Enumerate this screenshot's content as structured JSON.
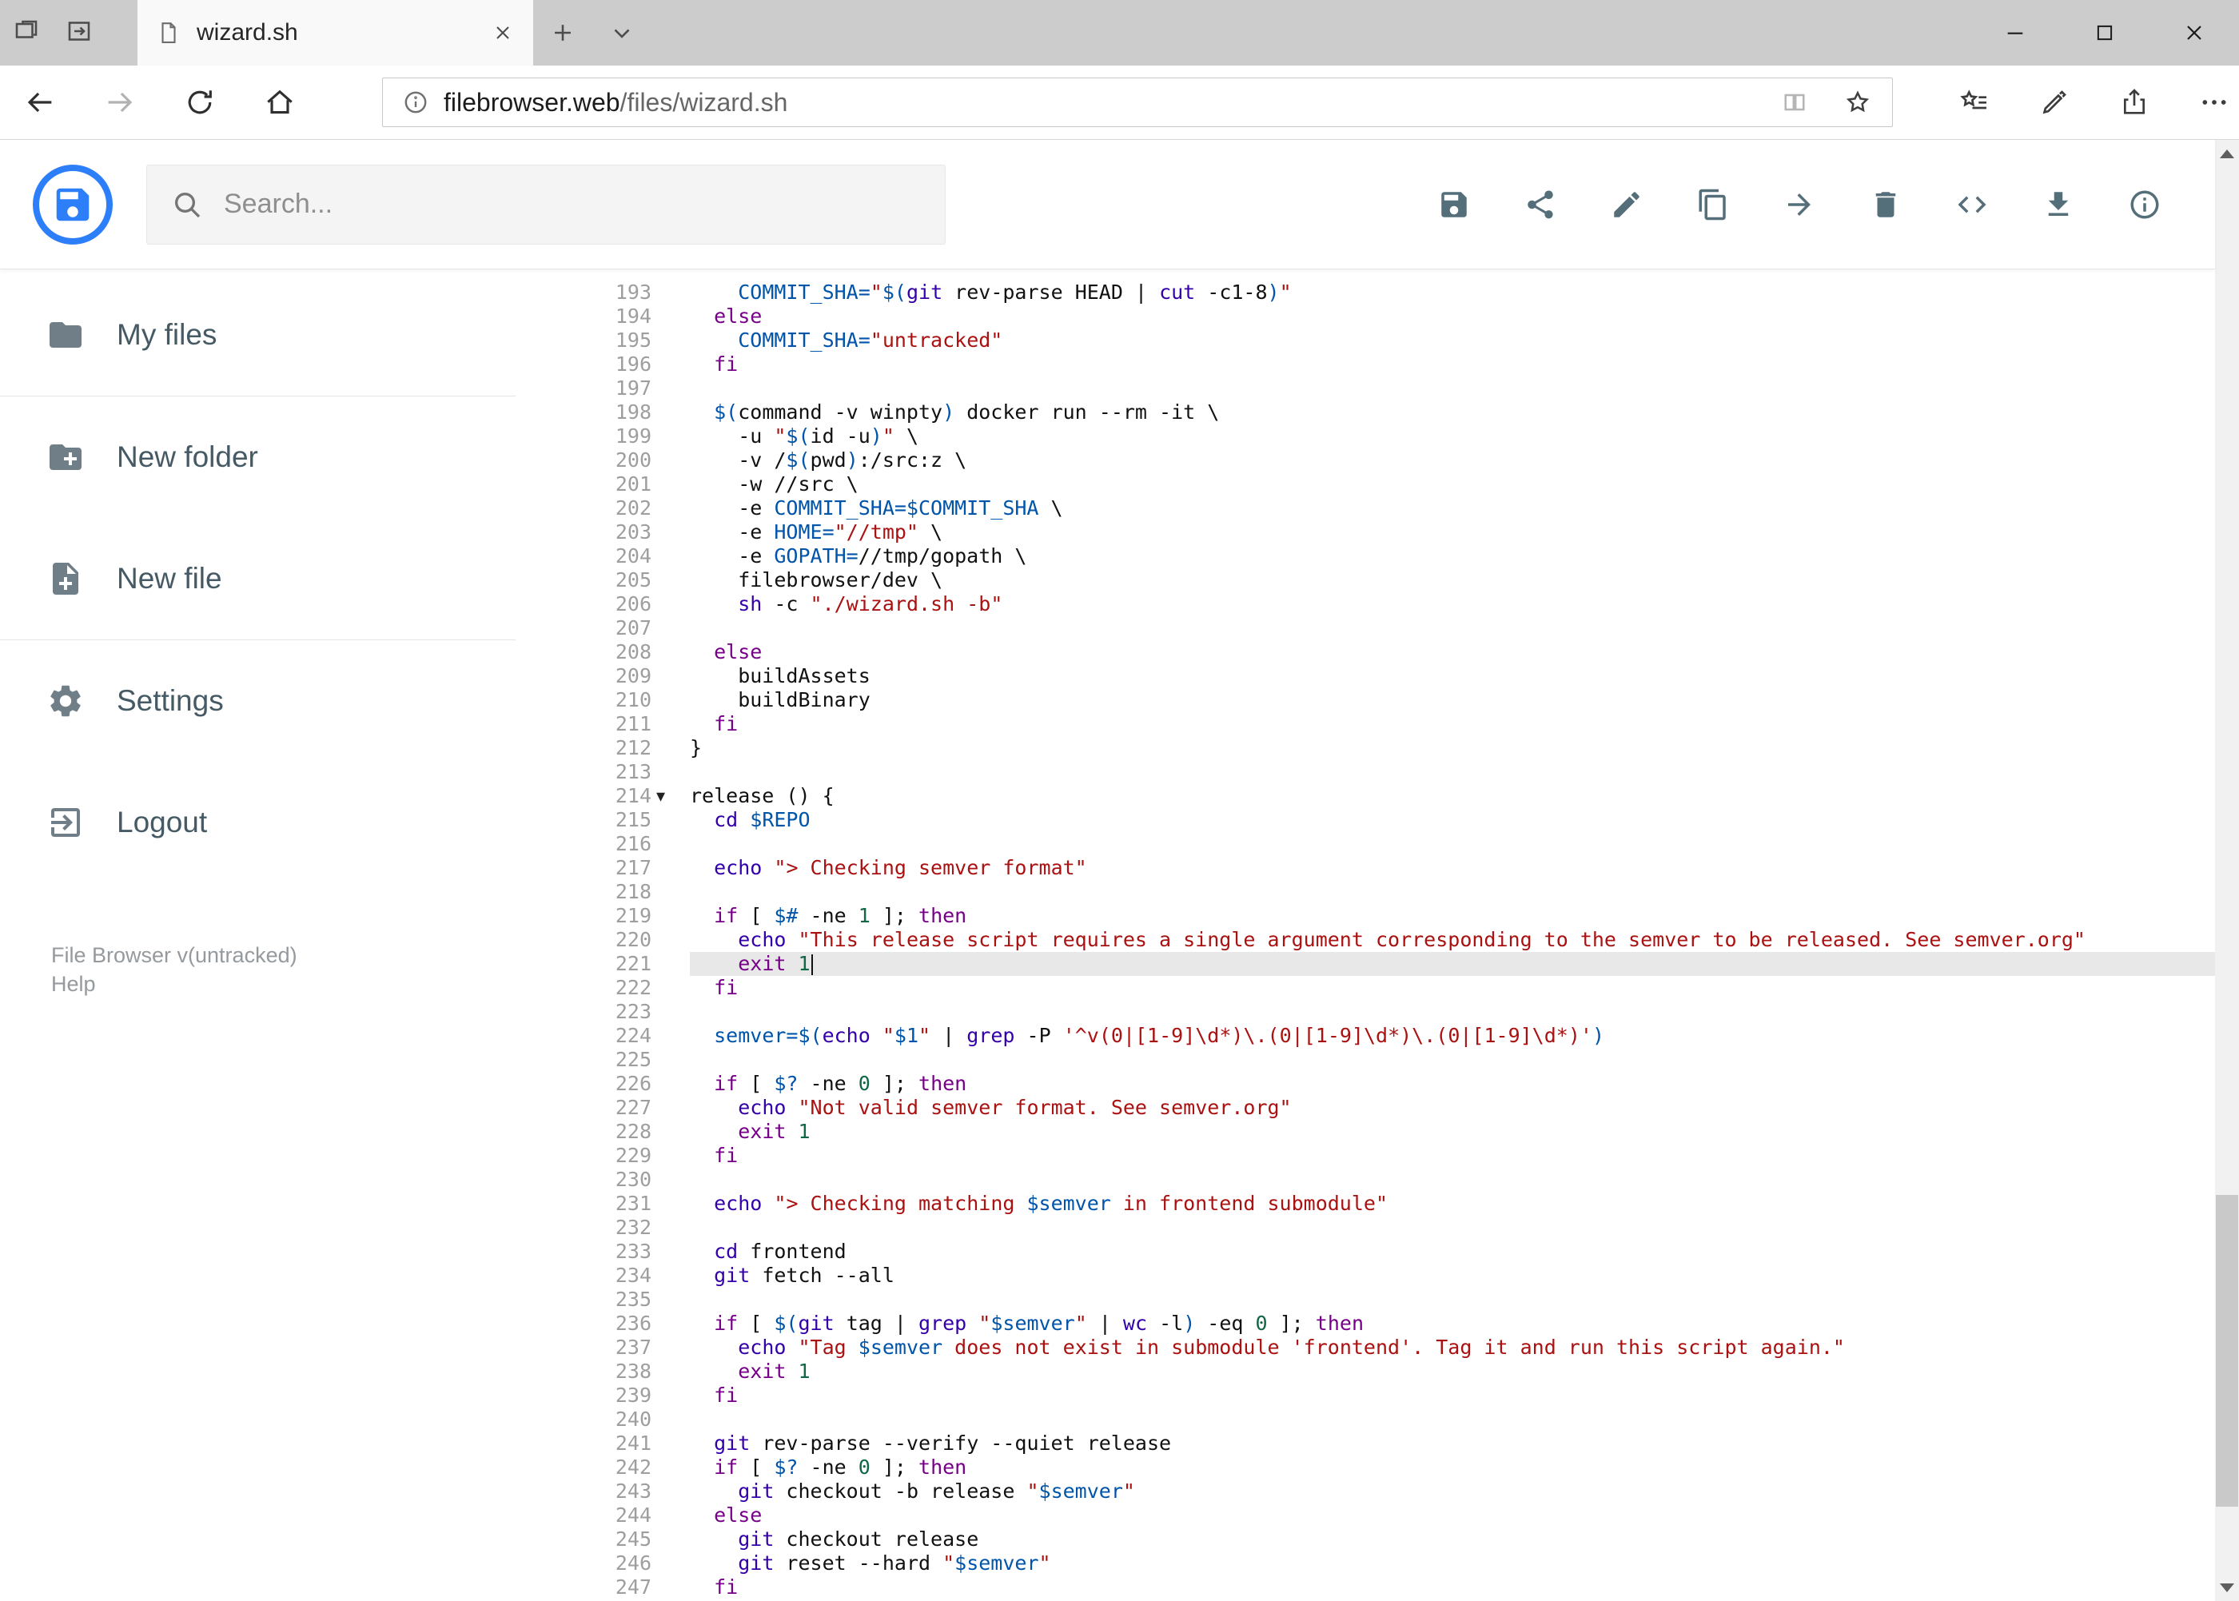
{
  "colors": {
    "accent": "#2d7ff9",
    "keyword": "#770088",
    "string": "#aa1111",
    "variable": "#0055aa",
    "number": "#116644",
    "builtin": "#3300aa"
  },
  "browser": {
    "tab_title": "wizard.sh",
    "url_domain": "filebrowser.web",
    "url_path": "/files/wizard.sh"
  },
  "header": {
    "search_placeholder": "Search...",
    "actions": [
      {
        "id": "save",
        "icon": "save"
      },
      {
        "id": "share",
        "icon": "share"
      },
      {
        "id": "edit",
        "icon": "pencil"
      },
      {
        "id": "copy",
        "icon": "copy"
      },
      {
        "id": "move",
        "icon": "arrow-forward"
      },
      {
        "id": "delete",
        "icon": "trash"
      },
      {
        "id": "code-view",
        "icon": "code"
      },
      {
        "id": "download",
        "icon": "download"
      },
      {
        "id": "info",
        "icon": "info"
      }
    ]
  },
  "sidebar": {
    "items": [
      {
        "id": "my-files",
        "label": "My files",
        "icon": "folder",
        "divider_after": true
      },
      {
        "id": "new-folder",
        "label": "New folder",
        "icon": "folder-plus",
        "divider_after": false
      },
      {
        "id": "new-file",
        "label": "New file",
        "icon": "file-plus",
        "divider_after": true
      },
      {
        "id": "settings",
        "label": "Settings",
        "icon": "gear",
        "divider_after": false
      },
      {
        "id": "logout",
        "label": "Logout",
        "icon": "logout",
        "divider_after": false
      }
    ],
    "footer_version": "File Browser v(untracked)",
    "footer_help": "Help"
  },
  "editor": {
    "active_line": 221,
    "fold_line": 214,
    "fold_marker": "▾",
    "lines": [
      {
        "n": 193,
        "t": [
          [
            "p",
            "    "
          ],
          [
            "v",
            "COMMIT_SHA="
          ],
          [
            "s",
            "\""
          ],
          [
            "v",
            "$("
          ],
          [
            "b",
            "git"
          ],
          [
            "p",
            " rev-parse HEAD | "
          ],
          [
            "b",
            "cut"
          ],
          [
            "p",
            " -c1-8"
          ],
          [
            "v",
            ")"
          ],
          [
            "s",
            "\""
          ]
        ]
      },
      {
        "n": 194,
        "t": [
          [
            "p",
            "  "
          ],
          [
            "k",
            "else"
          ]
        ]
      },
      {
        "n": 195,
        "t": [
          [
            "p",
            "    "
          ],
          [
            "v",
            "COMMIT_SHA="
          ],
          [
            "s",
            "\"untracked\""
          ]
        ]
      },
      {
        "n": 196,
        "t": [
          [
            "p",
            "  "
          ],
          [
            "k",
            "fi"
          ]
        ]
      },
      {
        "n": 197,
        "t": []
      },
      {
        "n": 198,
        "t": [
          [
            "p",
            "  "
          ],
          [
            "v",
            "$("
          ],
          [
            "p",
            "command -v winpty"
          ],
          [
            "v",
            ")"
          ],
          [
            "p",
            " docker run --rm -it \\"
          ]
        ]
      },
      {
        "n": 199,
        "t": [
          [
            "p",
            "    -u "
          ],
          [
            "s",
            "\""
          ],
          [
            "v",
            "$("
          ],
          [
            "p",
            "id -u"
          ],
          [
            "v",
            ")"
          ],
          [
            "s",
            "\""
          ],
          [
            "p",
            " \\"
          ]
        ]
      },
      {
        "n": 200,
        "t": [
          [
            "p",
            "    -v /"
          ],
          [
            "v",
            "$("
          ],
          [
            "p",
            "pwd"
          ],
          [
            "v",
            ")"
          ],
          [
            "p",
            ":/src:z \\"
          ]
        ]
      },
      {
        "n": 201,
        "t": [
          [
            "p",
            "    -w //src \\"
          ]
        ]
      },
      {
        "n": 202,
        "t": [
          [
            "p",
            "    -e "
          ],
          [
            "v",
            "COMMIT_SHA=$COMMIT_SHA"
          ],
          [
            "p",
            " \\"
          ]
        ]
      },
      {
        "n": 203,
        "t": [
          [
            "p",
            "    -e "
          ],
          [
            "v",
            "HOME="
          ],
          [
            "s",
            "\"//tmp\""
          ],
          [
            "p",
            " \\"
          ]
        ]
      },
      {
        "n": 204,
        "t": [
          [
            "p",
            "    -e "
          ],
          [
            "v",
            "GOPATH="
          ],
          [
            "p",
            "//tmp/gopath \\"
          ]
        ]
      },
      {
        "n": 205,
        "t": [
          [
            "p",
            "    filebrowser/dev \\"
          ]
        ]
      },
      {
        "n": 206,
        "t": [
          [
            "p",
            "    "
          ],
          [
            "b",
            "sh"
          ],
          [
            "p",
            " -c "
          ],
          [
            "s",
            "\"./wizard.sh -b\""
          ]
        ]
      },
      {
        "n": 207,
        "t": []
      },
      {
        "n": 208,
        "t": [
          [
            "p",
            "  "
          ],
          [
            "k",
            "else"
          ]
        ]
      },
      {
        "n": 209,
        "t": [
          [
            "p",
            "    buildAssets"
          ]
        ]
      },
      {
        "n": 210,
        "t": [
          [
            "p",
            "    buildBinary"
          ]
        ]
      },
      {
        "n": 211,
        "t": [
          [
            "p",
            "  "
          ],
          [
            "k",
            "fi"
          ]
        ]
      },
      {
        "n": 212,
        "t": [
          [
            "p",
            "}"
          ]
        ]
      },
      {
        "n": 213,
        "t": []
      },
      {
        "n": 214,
        "t": [
          [
            "p",
            "release () {"
          ]
        ]
      },
      {
        "n": 215,
        "t": [
          [
            "p",
            "  "
          ],
          [
            "b",
            "cd"
          ],
          [
            "p",
            " "
          ],
          [
            "v",
            "$REPO"
          ]
        ]
      },
      {
        "n": 216,
        "t": []
      },
      {
        "n": 217,
        "t": [
          [
            "p",
            "  "
          ],
          [
            "b",
            "echo"
          ],
          [
            "p",
            " "
          ],
          [
            "s",
            "\"> Checking semver format\""
          ]
        ]
      },
      {
        "n": 218,
        "t": []
      },
      {
        "n": 219,
        "t": [
          [
            "p",
            "  "
          ],
          [
            "k",
            "if"
          ],
          [
            "p",
            " [ "
          ],
          [
            "v",
            "$#"
          ],
          [
            "p",
            " -ne "
          ],
          [
            "n2",
            "1"
          ],
          [
            "p",
            " ]; "
          ],
          [
            "k",
            "then"
          ]
        ]
      },
      {
        "n": 220,
        "t": [
          [
            "p",
            "    "
          ],
          [
            "b",
            "echo"
          ],
          [
            "p",
            " "
          ],
          [
            "s",
            "\"This release script requires a single argument corresponding to the semver to be released. See semver.org\""
          ]
        ]
      },
      {
        "n": 221,
        "t": [
          [
            "p",
            "    "
          ],
          [
            "k",
            "exit"
          ],
          [
            "p",
            " "
          ],
          [
            "n2",
            "1"
          ]
        ]
      },
      {
        "n": 222,
        "t": [
          [
            "p",
            "  "
          ],
          [
            "k",
            "fi"
          ]
        ]
      },
      {
        "n": 223,
        "t": []
      },
      {
        "n": 224,
        "t": [
          [
            "p",
            "  "
          ],
          [
            "v",
            "semver="
          ],
          [
            "v",
            "$("
          ],
          [
            "b",
            "echo"
          ],
          [
            "p",
            " "
          ],
          [
            "s",
            "\""
          ],
          [
            "v",
            "$1"
          ],
          [
            "s",
            "\""
          ],
          [
            "p",
            " | "
          ],
          [
            "b",
            "grep"
          ],
          [
            "p",
            " -P "
          ],
          [
            "s",
            "'^v(0|[1-9]\\d*)\\.(0|[1-9]\\d*)\\.(0|[1-9]\\d*)'"
          ],
          [
            "v",
            ")"
          ]
        ]
      },
      {
        "n": 225,
        "t": []
      },
      {
        "n": 226,
        "t": [
          [
            "p",
            "  "
          ],
          [
            "k",
            "if"
          ],
          [
            "p",
            " [ "
          ],
          [
            "v",
            "$?"
          ],
          [
            "p",
            " -ne "
          ],
          [
            "n2",
            "0"
          ],
          [
            "p",
            " ]; "
          ],
          [
            "k",
            "then"
          ]
        ]
      },
      {
        "n": 227,
        "t": [
          [
            "p",
            "    "
          ],
          [
            "b",
            "echo"
          ],
          [
            "p",
            " "
          ],
          [
            "s",
            "\"Not valid semver format. See semver.org\""
          ]
        ]
      },
      {
        "n": 228,
        "t": [
          [
            "p",
            "    "
          ],
          [
            "k",
            "exit"
          ],
          [
            "p",
            " "
          ],
          [
            "n2",
            "1"
          ]
        ]
      },
      {
        "n": 229,
        "t": [
          [
            "p",
            "  "
          ],
          [
            "k",
            "fi"
          ]
        ]
      },
      {
        "n": 230,
        "t": []
      },
      {
        "n": 231,
        "t": [
          [
            "p",
            "  "
          ],
          [
            "b",
            "echo"
          ],
          [
            "p",
            " "
          ],
          [
            "s",
            "\"> Checking matching "
          ],
          [
            "v",
            "$semver"
          ],
          [
            "s",
            " in frontend submodule\""
          ]
        ]
      },
      {
        "n": 232,
        "t": []
      },
      {
        "n": 233,
        "t": [
          [
            "p",
            "  "
          ],
          [
            "b",
            "cd"
          ],
          [
            "p",
            " frontend"
          ]
        ]
      },
      {
        "n": 234,
        "t": [
          [
            "p",
            "  "
          ],
          [
            "b",
            "git"
          ],
          [
            "p",
            " fetch --all"
          ]
        ]
      },
      {
        "n": 235,
        "t": []
      },
      {
        "n": 236,
        "t": [
          [
            "p",
            "  "
          ],
          [
            "k",
            "if"
          ],
          [
            "p",
            " [ "
          ],
          [
            "v",
            "$("
          ],
          [
            "b",
            "git"
          ],
          [
            "p",
            " tag | "
          ],
          [
            "b",
            "grep"
          ],
          [
            "p",
            " "
          ],
          [
            "s",
            "\""
          ],
          [
            "v",
            "$semver"
          ],
          [
            "s",
            "\""
          ],
          [
            "p",
            " | "
          ],
          [
            "b",
            "wc"
          ],
          [
            "p",
            " -l"
          ],
          [
            "v",
            ")"
          ],
          [
            "p",
            " -eq "
          ],
          [
            "n2",
            "0"
          ],
          [
            "p",
            " ]; "
          ],
          [
            "k",
            "then"
          ]
        ]
      },
      {
        "n": 237,
        "t": [
          [
            "p",
            "    "
          ],
          [
            "b",
            "echo"
          ],
          [
            "p",
            " "
          ],
          [
            "s",
            "\"Tag "
          ],
          [
            "v",
            "$semver"
          ],
          [
            "s",
            " does not exist in submodule 'frontend'. Tag it and run this script again.\""
          ]
        ]
      },
      {
        "n": 238,
        "t": [
          [
            "p",
            "    "
          ],
          [
            "k",
            "exit"
          ],
          [
            "p",
            " "
          ],
          [
            "n2",
            "1"
          ]
        ]
      },
      {
        "n": 239,
        "t": [
          [
            "p",
            "  "
          ],
          [
            "k",
            "fi"
          ]
        ]
      },
      {
        "n": 240,
        "t": []
      },
      {
        "n": 241,
        "t": [
          [
            "p",
            "  "
          ],
          [
            "b",
            "git"
          ],
          [
            "p",
            " rev-parse --verify --quiet release"
          ]
        ]
      },
      {
        "n": 242,
        "t": [
          [
            "p",
            "  "
          ],
          [
            "k",
            "if"
          ],
          [
            "p",
            " [ "
          ],
          [
            "v",
            "$?"
          ],
          [
            "p",
            " -ne "
          ],
          [
            "n2",
            "0"
          ],
          [
            "p",
            " ]; "
          ],
          [
            "k",
            "then"
          ]
        ]
      },
      {
        "n": 243,
        "t": [
          [
            "p",
            "    "
          ],
          [
            "b",
            "git"
          ],
          [
            "p",
            " checkout -b release "
          ],
          [
            "s",
            "\""
          ],
          [
            "v",
            "$semver"
          ],
          [
            "s",
            "\""
          ]
        ]
      },
      {
        "n": 244,
        "t": [
          [
            "p",
            "  "
          ],
          [
            "k",
            "else"
          ]
        ]
      },
      {
        "n": 245,
        "t": [
          [
            "p",
            "    "
          ],
          [
            "b",
            "git"
          ],
          [
            "p",
            " checkout release"
          ]
        ]
      },
      {
        "n": 246,
        "t": [
          [
            "p",
            "    "
          ],
          [
            "b",
            "git"
          ],
          [
            "p",
            " reset --hard "
          ],
          [
            "s",
            "\""
          ],
          [
            "v",
            "$semver"
          ],
          [
            "s",
            "\""
          ]
        ]
      },
      {
        "n": 247,
        "t": [
          [
            "p",
            "  "
          ],
          [
            "k",
            "fi"
          ]
        ]
      }
    ]
  }
}
